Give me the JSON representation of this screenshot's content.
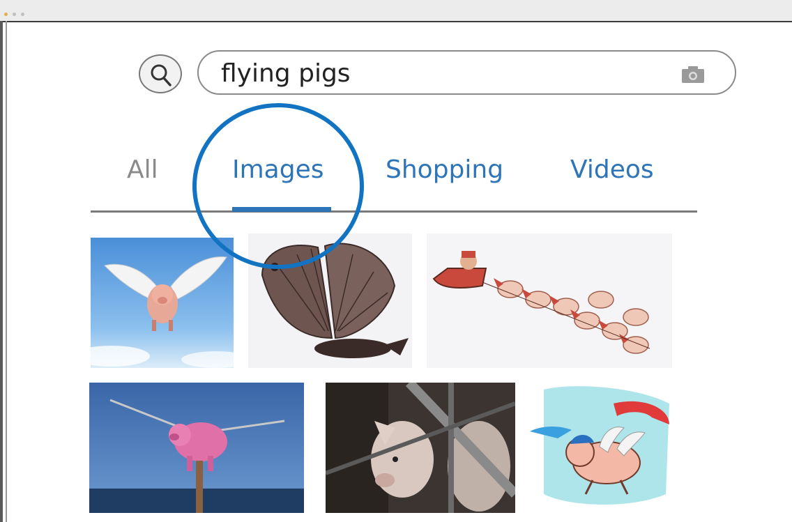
{
  "search": {
    "query": "flying pigs"
  },
  "tabs": [
    {
      "label": "All",
      "active": false
    },
    {
      "label": "Images",
      "active": true
    },
    {
      "label": "Shopping",
      "active": false
    },
    {
      "label": "Videos",
      "active": false
    }
  ],
  "results": [
    {
      "name": "winged pig in blue sky"
    },
    {
      "name": "butterfly-winged creature"
    },
    {
      "name": "santa sleigh pulled by pigs"
    },
    {
      "name": "pink pig statue with wings"
    },
    {
      "name": "real pigs in pen"
    },
    {
      "name": "cartoon pig with parachute"
    }
  ],
  "colors": {
    "accent": "#2e74b8",
    "highlight": "#1273c2",
    "inactive_tab": "#8a8a8a"
  }
}
